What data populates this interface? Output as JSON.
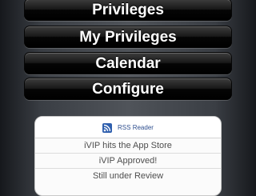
{
  "menu": {
    "buttons": [
      {
        "label": "Privileges"
      },
      {
        "label": "My Privileges"
      },
      {
        "label": "Calendar"
      },
      {
        "label": "Configure"
      }
    ]
  },
  "rss": {
    "title": "RSS Reader",
    "icon": "rss-feed-icon",
    "items": [
      {
        "label": "iVIP hits the App Store"
      },
      {
        "label": "iVIP Approved!"
      },
      {
        "label": "Still under Review"
      }
    ]
  },
  "colors": {
    "button_background": "#000000",
    "button_text": "#ffffff",
    "rss_title": "#2f4f8f",
    "rss_icon": "#2f5fae"
  }
}
